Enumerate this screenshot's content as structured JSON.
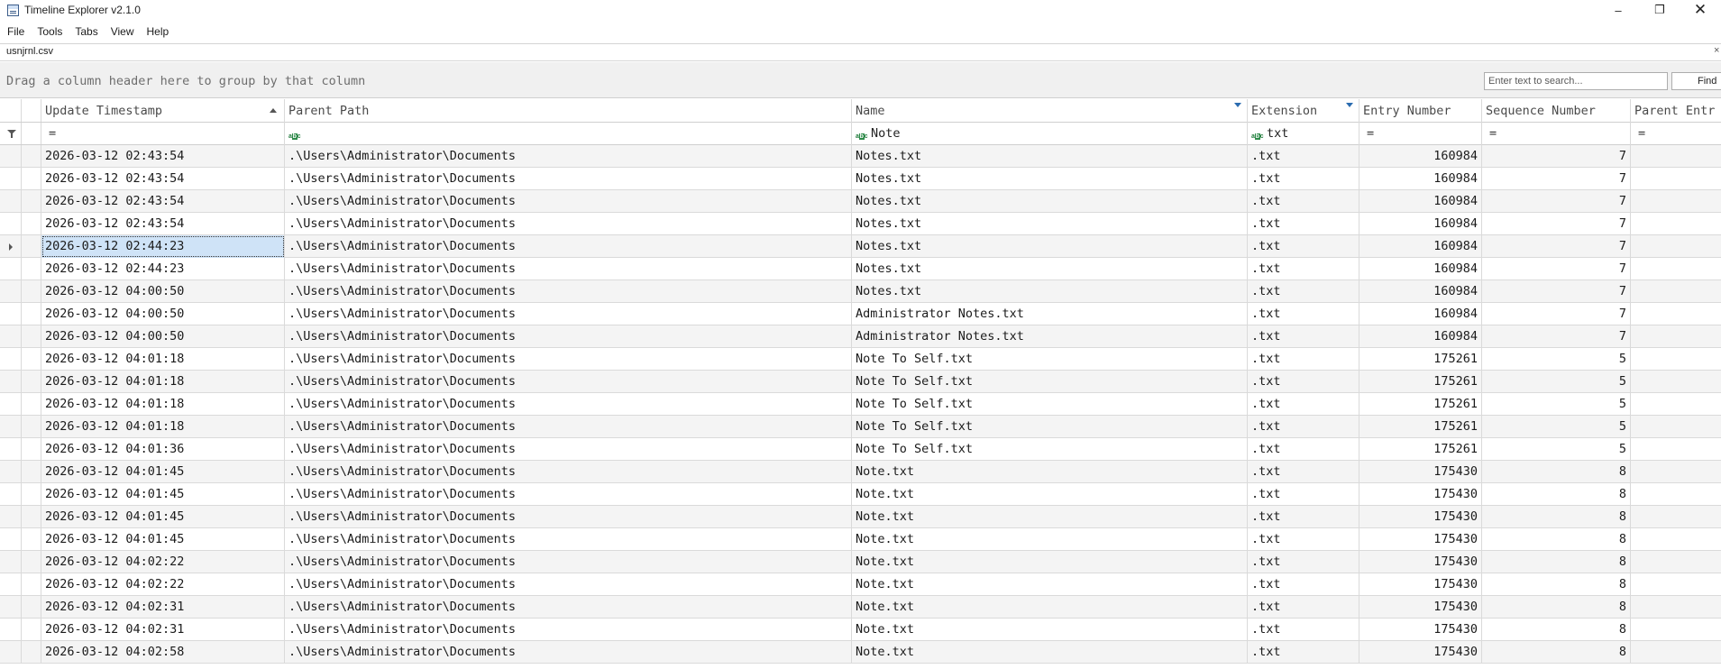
{
  "window": {
    "title": "Timeline Explorer v2.1.0",
    "controls": {
      "minimize": "–",
      "maximize": "❐",
      "close": "✕"
    }
  },
  "menu": [
    "File",
    "Tools",
    "Tabs",
    "View",
    "Help"
  ],
  "document_tab": {
    "label": "usnjrnl.csv",
    "close": "×"
  },
  "group_panel": {
    "hint": "Drag a column header here to group by that column"
  },
  "search": {
    "placeholder": "Enter text to search...",
    "value": "",
    "find_label": "Find"
  },
  "columns": [
    {
      "key": "ts",
      "label": "Update Timestamp",
      "sort": "ascending"
    },
    {
      "key": "pp",
      "label": "Parent Path"
    },
    {
      "key": "nm",
      "label": "Name",
      "filtered": true
    },
    {
      "key": "ext",
      "label": "Extension",
      "filtered": true
    },
    {
      "key": "en",
      "label": "Entry Number"
    },
    {
      "key": "sn",
      "label": "Sequence Number"
    },
    {
      "key": "pe",
      "label": "Parent Entr"
    }
  ],
  "filters": {
    "ts": {
      "op": "=",
      "value": ""
    },
    "pp": {
      "op": "abc",
      "value": ""
    },
    "nm": {
      "op": "abc",
      "value": "Note"
    },
    "ext": {
      "op": "abc",
      "value": "txt"
    },
    "en": {
      "op": "=",
      "value": ""
    },
    "sn": {
      "op": "=",
      "value": ""
    },
    "pe": {
      "op": "=",
      "value": ""
    }
  },
  "selected_row_index": 4,
  "rows": [
    {
      "ts": "2026-03-12 02:43:54",
      "pp": ".\\Users\\Administrator\\Documents",
      "nm": "Notes.txt",
      "ext": ".txt",
      "en": "160984",
      "sn": "7"
    },
    {
      "ts": "2026-03-12 02:43:54",
      "pp": ".\\Users\\Administrator\\Documents",
      "nm": "Notes.txt",
      "ext": ".txt",
      "en": "160984",
      "sn": "7"
    },
    {
      "ts": "2026-03-12 02:43:54",
      "pp": ".\\Users\\Administrator\\Documents",
      "nm": "Notes.txt",
      "ext": ".txt",
      "en": "160984",
      "sn": "7"
    },
    {
      "ts": "2026-03-12 02:43:54",
      "pp": ".\\Users\\Administrator\\Documents",
      "nm": "Notes.txt",
      "ext": ".txt",
      "en": "160984",
      "sn": "7"
    },
    {
      "ts": "2026-03-12 02:44:23",
      "pp": ".\\Users\\Administrator\\Documents",
      "nm": "Notes.txt",
      "ext": ".txt",
      "en": "160984",
      "sn": "7"
    },
    {
      "ts": "2026-03-12 02:44:23",
      "pp": ".\\Users\\Administrator\\Documents",
      "nm": "Notes.txt",
      "ext": ".txt",
      "en": "160984",
      "sn": "7"
    },
    {
      "ts": "2026-03-12 04:00:50",
      "pp": ".\\Users\\Administrator\\Documents",
      "nm": "Notes.txt",
      "ext": ".txt",
      "en": "160984",
      "sn": "7"
    },
    {
      "ts": "2026-03-12 04:00:50",
      "pp": ".\\Users\\Administrator\\Documents",
      "nm": "Administrator Notes.txt",
      "ext": ".txt",
      "en": "160984",
      "sn": "7"
    },
    {
      "ts": "2026-03-12 04:00:50",
      "pp": ".\\Users\\Administrator\\Documents",
      "nm": "Administrator Notes.txt",
      "ext": ".txt",
      "en": "160984",
      "sn": "7"
    },
    {
      "ts": "2026-03-12 04:01:18",
      "pp": ".\\Users\\Administrator\\Documents",
      "nm": "Note To Self.txt",
      "ext": ".txt",
      "en": "175261",
      "sn": "5"
    },
    {
      "ts": "2026-03-12 04:01:18",
      "pp": ".\\Users\\Administrator\\Documents",
      "nm": "Note To Self.txt",
      "ext": ".txt",
      "en": "175261",
      "sn": "5"
    },
    {
      "ts": "2026-03-12 04:01:18",
      "pp": ".\\Users\\Administrator\\Documents",
      "nm": "Note To Self.txt",
      "ext": ".txt",
      "en": "175261",
      "sn": "5"
    },
    {
      "ts": "2026-03-12 04:01:18",
      "pp": ".\\Users\\Administrator\\Documents",
      "nm": "Note To Self.txt",
      "ext": ".txt",
      "en": "175261",
      "sn": "5"
    },
    {
      "ts": "2026-03-12 04:01:36",
      "pp": ".\\Users\\Administrator\\Documents",
      "nm": "Note To Self.txt",
      "ext": ".txt",
      "en": "175261",
      "sn": "5"
    },
    {
      "ts": "2026-03-12 04:01:45",
      "pp": ".\\Users\\Administrator\\Documents",
      "nm": "Note.txt",
      "ext": ".txt",
      "en": "175430",
      "sn": "8"
    },
    {
      "ts": "2026-03-12 04:01:45",
      "pp": ".\\Users\\Administrator\\Documents",
      "nm": "Note.txt",
      "ext": ".txt",
      "en": "175430",
      "sn": "8"
    },
    {
      "ts": "2026-03-12 04:01:45",
      "pp": ".\\Users\\Administrator\\Documents",
      "nm": "Note.txt",
      "ext": ".txt",
      "en": "175430",
      "sn": "8"
    },
    {
      "ts": "2026-03-12 04:01:45",
      "pp": ".\\Users\\Administrator\\Documents",
      "nm": "Note.txt",
      "ext": ".txt",
      "en": "175430",
      "sn": "8"
    },
    {
      "ts": "2026-03-12 04:02:22",
      "pp": ".\\Users\\Administrator\\Documents",
      "nm": "Note.txt",
      "ext": ".txt",
      "en": "175430",
      "sn": "8"
    },
    {
      "ts": "2026-03-12 04:02:22",
      "pp": ".\\Users\\Administrator\\Documents",
      "nm": "Note.txt",
      "ext": ".txt",
      "en": "175430",
      "sn": "8"
    },
    {
      "ts": "2026-03-12 04:02:31",
      "pp": ".\\Users\\Administrator\\Documents",
      "nm": "Note.txt",
      "ext": ".txt",
      "en": "175430",
      "sn": "8"
    },
    {
      "ts": "2026-03-12 04:02:31",
      "pp": ".\\Users\\Administrator\\Documents",
      "nm": "Note.txt",
      "ext": ".txt",
      "en": "175430",
      "sn": "8"
    },
    {
      "ts": "2026-03-12 04:02:58",
      "pp": ".\\Users\\Administrator\\Documents",
      "nm": "Note.txt",
      "ext": ".txt",
      "en": "175430",
      "sn": "8"
    }
  ]
}
